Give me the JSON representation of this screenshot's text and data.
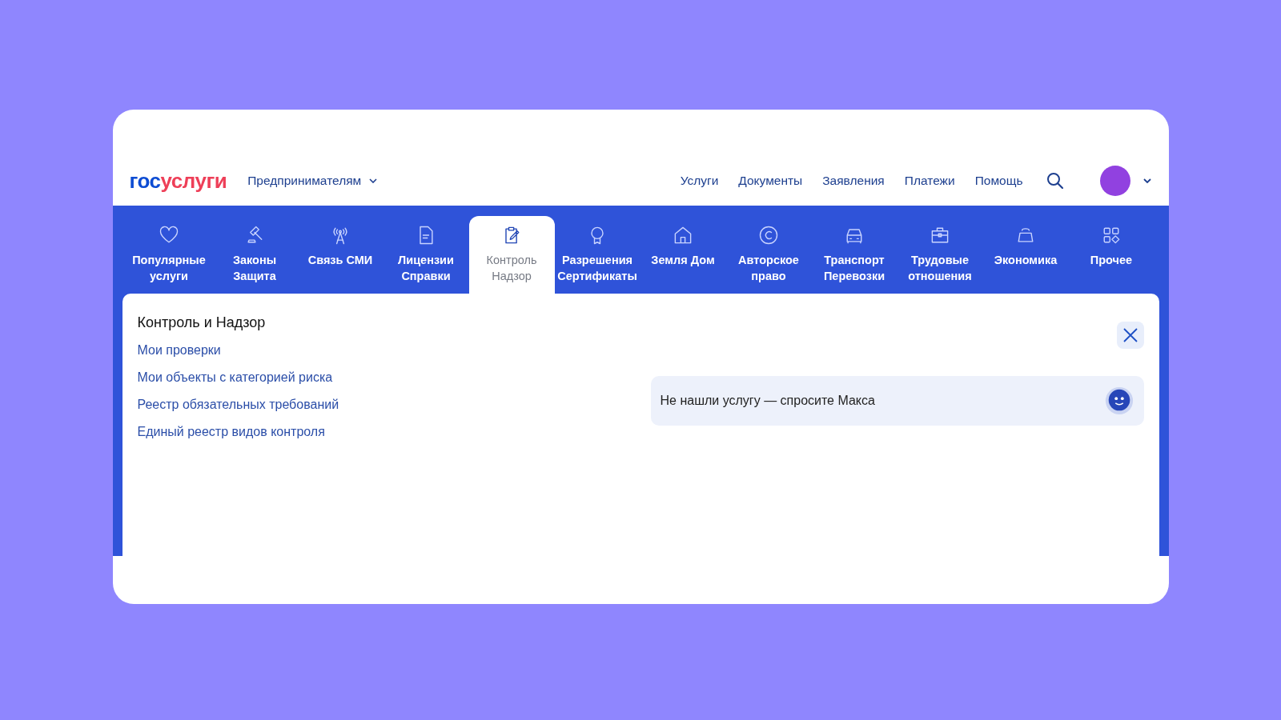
{
  "logo": {
    "prefix": "гос",
    "suffix": "услуги"
  },
  "audience_menu": {
    "label": "Предпринимателям"
  },
  "nav": [
    "Услуги",
    "Документы",
    "Заявления",
    "Платежи",
    "Помощь"
  ],
  "categories": [
    {
      "label": "Популярные услуги",
      "selected": false
    },
    {
      "label": "Законы Защита",
      "selected": false
    },
    {
      "label": "Связь СМИ",
      "selected": false
    },
    {
      "label": "Лицензии Справки",
      "selected": false
    },
    {
      "label": "Контроль Надзор",
      "selected": true
    },
    {
      "label": "Разрешения Сертификаты",
      "selected": false
    },
    {
      "label": "Земля Дом",
      "selected": false
    },
    {
      "label": "Авторское право",
      "selected": false
    },
    {
      "label": "Транспорт Перевозки",
      "selected": false
    },
    {
      "label": "Трудовые отношения",
      "selected": false
    },
    {
      "label": "Экономика",
      "selected": false
    },
    {
      "label": "Прочее",
      "selected": false
    }
  ],
  "panel": {
    "title": "Контроль и Надзор",
    "links": [
      "Мои проверки",
      "Мои объекты с категорией риска",
      "Реестр обязательных требований",
      "Единый реестр видов контроля"
    ],
    "assistant_prompt": "Не нашли услугу — спросите Макса"
  }
}
